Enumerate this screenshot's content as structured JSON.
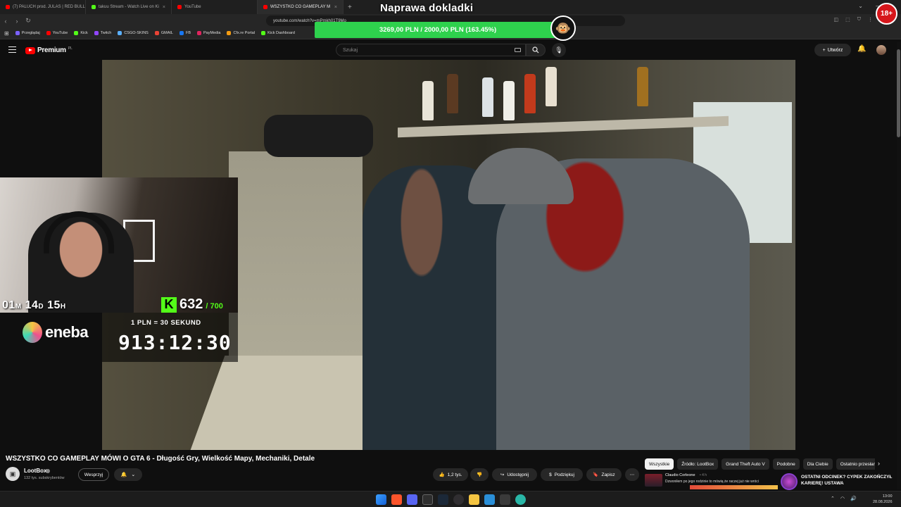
{
  "browser": {
    "tabs": [
      {
        "title": "(7) PALUCH prod. JULAS | RED BULL",
        "color": "#ff0000",
        "active": false
      },
      {
        "title": "takuu Stream - Watch Live on Ki",
        "color": "#53fc18",
        "active": false
      },
      {
        "title": "YouTube",
        "color": "#ff0000",
        "active": false
      },
      {
        "title": "WSZYSTKO CO GAMEPLAY M",
        "color": "#ff0000",
        "active": true
      }
    ],
    "url": "youtube.com/watch?v=mPmkh01T9Mo",
    "bookmarks": [
      "Przeglądaj",
      "YouTube",
      "Kick",
      "Twitch",
      "CSGO-SKINS",
      "GMAIL",
      "FB",
      "PayMedia",
      "Cfx.re Portal",
      "Kick Dashboard"
    ]
  },
  "overlay": {
    "title": "Naprawa dokladki",
    "donation_progress": "3269,00 PLN / 2000,00 PLN  (163.45%)",
    "age_badge": "18+",
    "countdown_days": "01",
    "countdown_d_unit": "M",
    "countdown_hours": "14",
    "countdown_h_unit": "D",
    "countdown_min": "15",
    "countdown_m_unit": "H",
    "kick_icon": "K",
    "kick_count": "632",
    "kick_target": "/ 700",
    "sponsor": "eneba",
    "timer_rate": "1 PLN = 30 SEKUND",
    "timer_value": "913:12:30"
  },
  "youtube": {
    "logo_text": "Premium",
    "logo_region": "PL",
    "search_placeholder": "Szukaj",
    "create_label": "Utwórz",
    "video_title": "WSZYSTKO CO GAMEPLAY MÓWI O GTA 6 - Długość Gry, Wielkość Mapy, Mechaniki, Detale",
    "channel_name": "LootBox",
    "subscribers": "132 tys. subskrybentów",
    "support_label": "Wesprzyj",
    "likes": "1,2 tys.",
    "share_label": "Udostępnij",
    "thanks_label": "Podziękuj",
    "save_label": "Zapisz",
    "chips": [
      "Wszystkie",
      "Źródło: LootBox",
      "Grand Theft Auto V",
      "Podobne",
      "Dla Ciebie",
      "Ostatnio przesłane"
    ],
    "related": {
      "commenter": "Claudio Corleone",
      "comment_age": "• 4 h",
      "comment": "Dzwoniłem po jego rodzinie to mówią że raczej już nie wróci",
      "next_title": "OSTATNI ODCINEK? CYPEK ZAKOŃCZYŁ KARIERĘ! USTAWA"
    }
  },
  "taskbar": {
    "time": "13:00",
    "date": "28.08.2026"
  },
  "colors": {
    "kick_green": "#53fc18",
    "donation_green": "#2ed14d",
    "yt_red": "#ff0000"
  }
}
